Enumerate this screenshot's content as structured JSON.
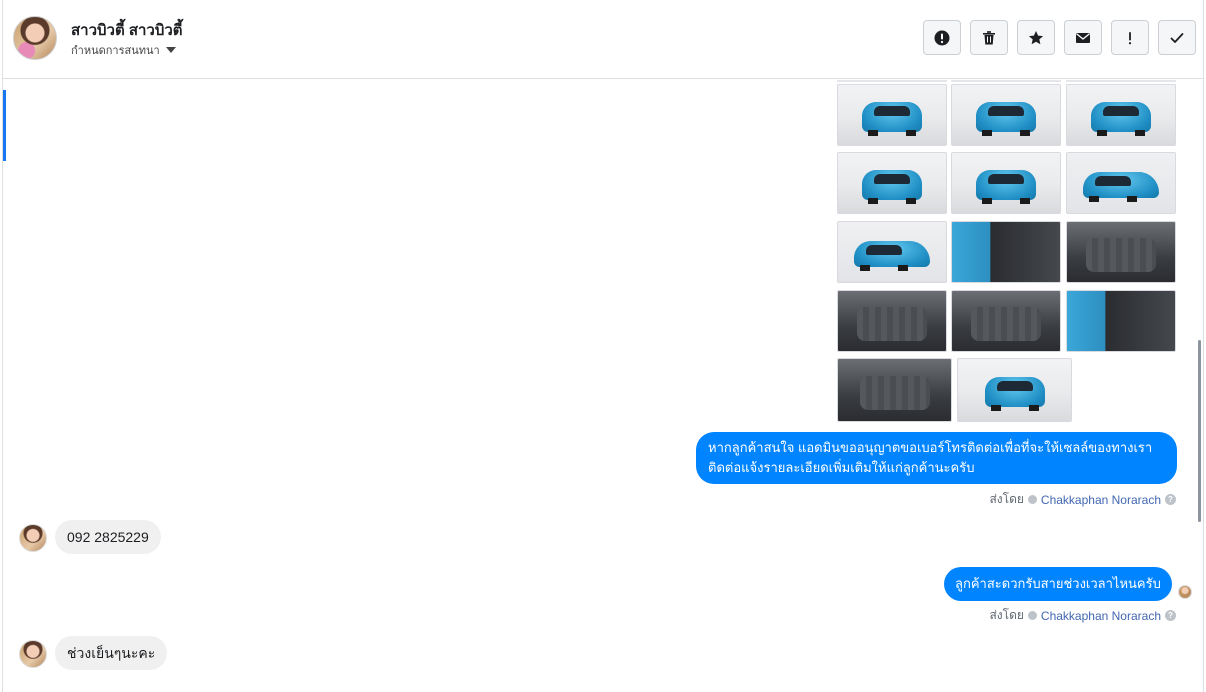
{
  "header": {
    "contact_name": "สาวบิวตี้ สาวบิวตี้",
    "stage_label": "กำหนดการสนทนา",
    "actions": [
      {
        "name": "report-button",
        "icon": "exclamation-circle-icon"
      },
      {
        "name": "delete-button",
        "icon": "trash-icon"
      },
      {
        "name": "star-button",
        "icon": "star-icon"
      },
      {
        "name": "unread-button",
        "icon": "envelope-icon"
      },
      {
        "name": "follow-up-button",
        "icon": "exclamation-icon"
      },
      {
        "name": "mark-done-button",
        "icon": "check-icon"
      }
    ]
  },
  "conversation": {
    "photo_grid": {
      "rows": [
        [
          "ext",
          "ext",
          "ext"
        ],
        [
          "ext",
          "ext",
          "side"
        ],
        [
          "side",
          "door",
          "int"
        ],
        [
          "int",
          "int",
          "door"
        ],
        [
          "int",
          "ext"
        ]
      ]
    },
    "messages": [
      {
        "direction": "out",
        "lines": [
          "หากลูกค้าสนใจ แอดมินขออนุญาตขอเบอร์โทรติดต่อเพื่อที่จะให้เซลล์ของทางเรา",
          "ติดต่อแจ้งรายละเอียดเพิ่มเติมให้แก่ลูกค้านะครับ"
        ],
        "sent_by_prefix": "ส่งโดย",
        "agent": "Chakkaphan Norarach"
      },
      {
        "direction": "in",
        "text": "092 2825229"
      },
      {
        "direction": "out",
        "text": "ลูกค้าสะดวกรับสายช่วงเวลาไหนครับ",
        "sent_by_prefix": "ส่งโดย",
        "agent": "Chakkaphan Norarach"
      },
      {
        "direction": "in",
        "text": "ช่วงเย็นๆนะคะ"
      }
    ]
  },
  "colors": {
    "accent": "#1877f2",
    "bubble_out": "#0084ff",
    "bubble_in": "#f0f0f0",
    "agent_link": "#4267b2"
  }
}
